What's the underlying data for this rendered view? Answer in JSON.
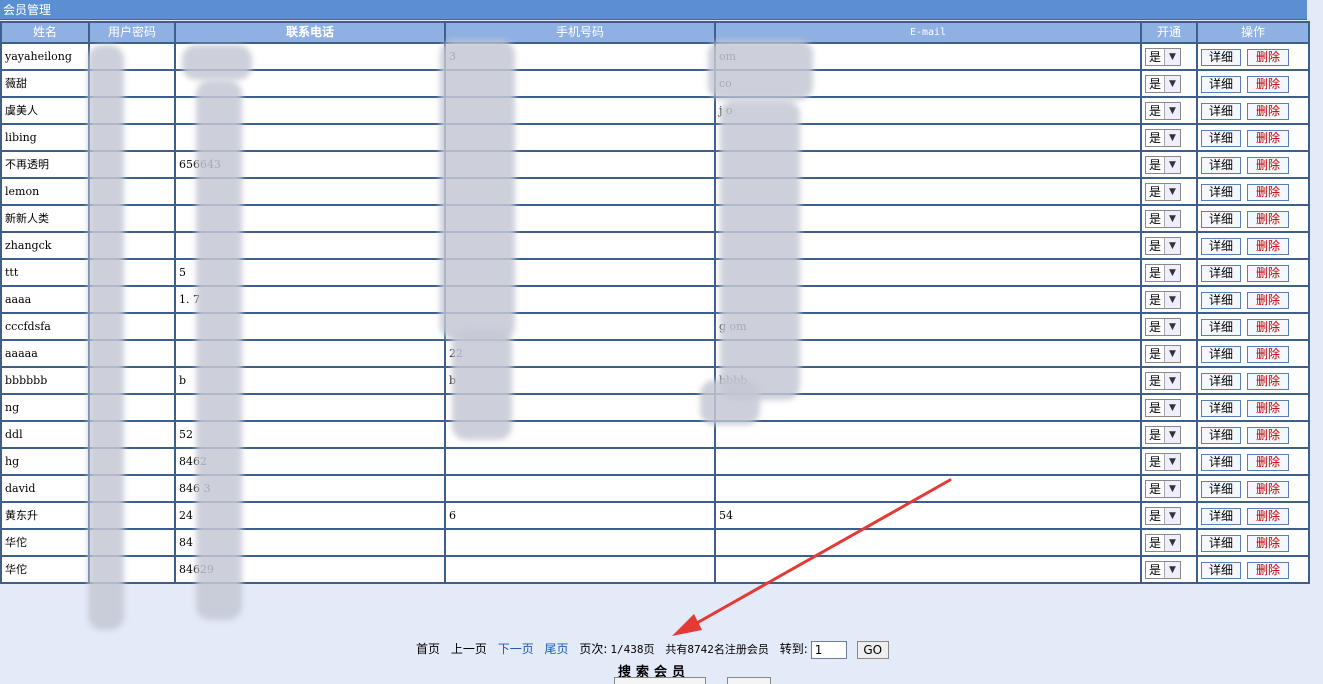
{
  "panel_title": "会员管理",
  "columns": [
    "姓名",
    "用户密码",
    "联系电话",
    "手机号码",
    "E-mail",
    "开通",
    "操作"
  ],
  "rows": [
    {
      "name": "yayaheilong",
      "password": "",
      "phone": "",
      "mobile": "3",
      "email": "om"
    },
    {
      "name": "薇甜",
      "password": "",
      "phone": "",
      "mobile": "",
      "email": "co"
    },
    {
      "name": "虞美人",
      "password": "",
      "phone": "",
      "mobile": "",
      "email": "j o"
    },
    {
      "name": "libing",
      "password": "",
      "phone": "",
      "mobile": "",
      "email": ""
    },
    {
      "name": "不再透明",
      "password": "",
      "phone": "656643",
      "mobile": "",
      "email": ""
    },
    {
      "name": "lemon",
      "password": "",
      "phone": "",
      "mobile": "",
      "email": ""
    },
    {
      "name": "新新人类",
      "password": "",
      "phone": "",
      "mobile": "",
      "email": ""
    },
    {
      "name": "zhangck",
      "password": "",
      "phone": "",
      "mobile": "",
      "email": ""
    },
    {
      "name": "ttt",
      "password": "",
      "phone": "5",
      "mobile": "",
      "email": ""
    },
    {
      "name": "aaaa",
      "password": "",
      "phone": "1. 7",
      "mobile": "",
      "email": ""
    },
    {
      "name": "cccfdsfa",
      "password": "",
      "phone": "",
      "mobile": "",
      "email": "g om"
    },
    {
      "name": "aaaaa",
      "password": "",
      "phone": "",
      "mobile": "22",
      "email": ""
    },
    {
      "name": "bbbbbb",
      "password": "",
      "phone": "b",
      "mobile": "b",
      "email": "bbbb"
    },
    {
      "name": "ng",
      "password": "",
      "phone": "",
      "mobile": "",
      "email": ""
    },
    {
      "name": "ddl",
      "password": "",
      "phone": "52",
      "mobile": "",
      "email": ""
    },
    {
      "name": "hg",
      "password": "",
      "phone": "8462",
      "mobile": "",
      "email": ""
    },
    {
      "name": "david",
      "password": "",
      "phone": "846 3",
      "mobile": "",
      "email": ""
    },
    {
      "name": "黄东升",
      "password": "",
      "phone": "24",
      "mobile": "6",
      "email": "54"
    },
    {
      "name": "华佗",
      "password": "",
      "phone": "84",
      "mobile": "",
      "email": ""
    },
    {
      "name": "华佗",
      "password": "",
      "phone": "84629",
      "mobile": "",
      "email": ""
    }
  ],
  "open_value": "是",
  "detail_label": "详细",
  "delete_label": "删除",
  "pager": {
    "first": "首页",
    "prev": "上一页",
    "next": "下一页",
    "last": "尾页",
    "page_label": "页次:",
    "page_info": "1/438页",
    "total_text": "共有8742名注册会员",
    "goto_label": "转到:",
    "goto_value": "1",
    "go_label": "GO"
  },
  "search_title": "搜索会员",
  "colors": {
    "header_bg": "#8fb0e3",
    "title_bg": "#5b8fd4",
    "border": "#3d5f8c",
    "arrow": "#e53935",
    "delete_text": "#c00000",
    "link": "#1b5cb8"
  },
  "icons": {
    "select_arrow": "chevron-down-icon",
    "annotation": "red-arrow-icon"
  }
}
